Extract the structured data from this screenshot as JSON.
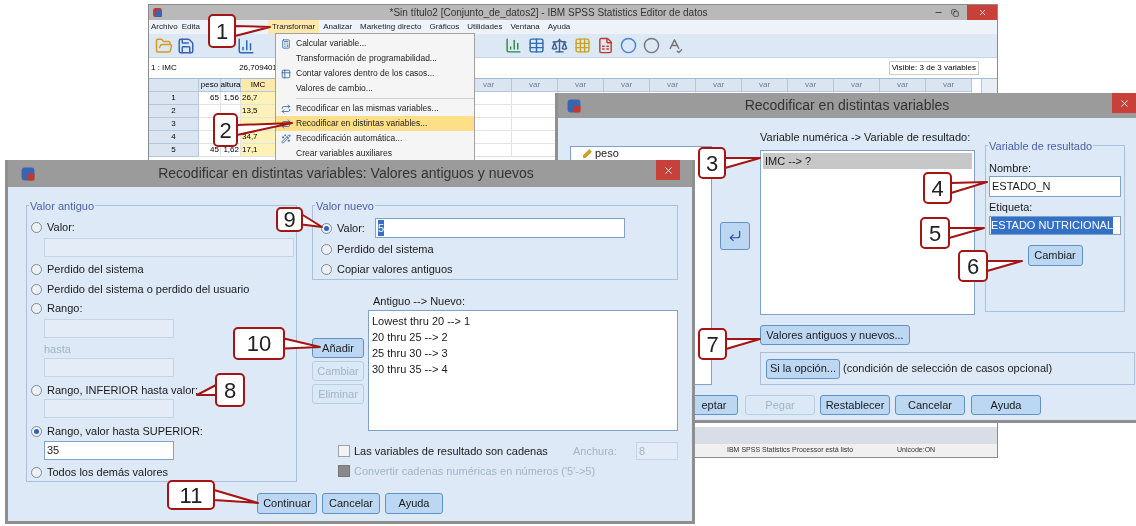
{
  "main_window": {
    "title": "*Sin título2 [Conjunto_de_datos2] - IBM SPSS Statistics Editor de datos",
    "menu": [
      {
        "label": "Archivo",
        "selected": false
      },
      {
        "label": "Edita",
        "selected": false
      },
      {
        "label": "Transformar",
        "selected": true
      },
      {
        "label": "Analizar",
        "selected": false
      },
      {
        "label": "Marketing directo",
        "selected": false
      },
      {
        "label": "Gráficos",
        "selected": false
      },
      {
        "label": "Utilidades",
        "selected": false
      },
      {
        "label": "Ventana",
        "selected": false
      },
      {
        "label": "Ayuda",
        "selected": false
      }
    ],
    "cell_reference": "1 : IMC",
    "cell_value": "26,709401",
    "visible_count": "Visible: 3 de 3 variables",
    "grid": {
      "columns": [
        "peso",
        "altura",
        "IMC"
      ],
      "var_columns": [
        "var",
        "var",
        "var",
        "var",
        "var",
        "var",
        "var",
        "var",
        "var",
        "var",
        "var"
      ],
      "rows": [
        {
          "number": "1",
          "cells": [
            "65",
            "1,56",
            "26,7"
          ]
        },
        {
          "number": "2",
          "cells": [
            null,
            null,
            "13,5"
          ]
        },
        {
          "number": "3",
          "cells": [
            null,
            null,
            null
          ]
        },
        {
          "number": "4",
          "cells": [
            null,
            null,
            "34,7"
          ]
        },
        {
          "number": "5",
          "cells": [
            "45",
            "1,62",
            "17,1"
          ]
        }
      ]
    },
    "status_bar": [
      "IBM SPSS Statistics Processor está listo",
      "Unicode:ON"
    ]
  },
  "transform_menu": [
    {
      "kind": "icon-item",
      "label": "Calcular variable...",
      "selected": false
    },
    {
      "kind": "plain-item",
      "label": "Transformación de programabilidad...",
      "selected": false
    },
    {
      "kind": "icon-item",
      "label": "Contar valores dentro de los casos...",
      "selected": false
    },
    {
      "kind": "plain-item",
      "label": "Valores de cambio...",
      "selected": false
    },
    {
      "kind": "separator"
    },
    {
      "kind": "icon-item",
      "label": "Recodificar en las mismas variables...",
      "selected": false
    },
    {
      "kind": "icon-item",
      "label": "Recodificar en distintas variables...",
      "selected": true
    },
    {
      "kind": "icon-item",
      "label": "Recodificación automática...",
      "selected": false
    },
    {
      "kind": "plain-item",
      "label": "Crear variables auxiliares",
      "selected": false
    }
  ],
  "recode_dialog": {
    "title": "Recodificar en distintas variables",
    "variables": [
      "peso"
    ],
    "mapping_label": "Variable numérica -> Variable de resultado:",
    "mappings": [
      {
        "label": "IMC --> ?",
        "selected": true
      }
    ],
    "output_group": {
      "legend": "Variable de resultado",
      "name_label": "Nombre:",
      "name_value": "ESTADO_N",
      "label_label": "Etiqueta:",
      "label_value": "ESTADO NUTRICIONAL",
      "label_selected": true,
      "change_button": "Cambiar"
    },
    "old_new_button": "Valores antiguos y nuevos...",
    "if_button": "Si la opción...",
    "if_note": "(condición de selección de casos opcional)",
    "buttons": [
      {
        "label": "eptar",
        "disabled": false
      },
      {
        "label": "Pegar",
        "disabled": true
      },
      {
        "label": "Restablecer",
        "disabled": false
      },
      {
        "label": "Cancelar",
        "disabled": false
      },
      {
        "label": "Ayuda",
        "disabled": false
      }
    ]
  },
  "values_dialog": {
    "title": "Recodificar en distintas variables: Valores antiguos y nuevos",
    "old_value": {
      "legend": "Valor antiguo",
      "options": [
        {
          "kind": "radio",
          "label": "Valor:",
          "selected": false
        },
        {
          "kind": "field",
          "disabled": true
        },
        {
          "kind": "radio",
          "label": "Perdido del sistema",
          "selected": false
        },
        {
          "kind": "radio",
          "label": "Perdido del sistema o perdido del usuario",
          "selected": false
        },
        {
          "kind": "radio",
          "label": "Rango:",
          "selected": false
        },
        {
          "kind": "field",
          "disabled": true
        },
        {
          "kind": "caption",
          "label": "hasta",
          "disabled": true
        },
        {
          "kind": "field",
          "disabled": true
        },
        {
          "kind": "radio",
          "label": "Rango, INFERIOR hasta valor:",
          "selected": false
        },
        {
          "kind": "field",
          "disabled": true
        },
        {
          "kind": "radio",
          "label": "Rango, valor hasta SUPERIOR:",
          "selected": true
        },
        {
          "kind": "field",
          "disabled": false,
          "value": "35"
        },
        {
          "kind": "radio",
          "label": "Todos los demás valores",
          "selected": false
        }
      ]
    },
    "new_value": {
      "legend": "Valor nuevo",
      "value": "5",
      "options": [
        {
          "label": "Valor:",
          "selected": true
        },
        {
          "label": "Perdido del sistema",
          "selected": false
        },
        {
          "label": "Copiar valores antiguos",
          "selected": false
        }
      ]
    },
    "list_label": "Antiguo --> Nuevo:",
    "list": [
      "Lowest thru 20 --> 1",
      "20 thru 25 --> 2",
      "25 thru 30 --> 3",
      "30 thru 35 --> 4"
    ],
    "side_buttons": [
      {
        "label": "Añadir",
        "disabled": false
      },
      {
        "label": "Cambiar",
        "disabled": true
      },
      {
        "label": "Eliminar",
        "disabled": true
      }
    ],
    "string_check": {
      "label": "Las variables de resultado son cadenas",
      "checked": false
    },
    "width_label": "Anchura:",
    "width_value": "8",
    "width_disabled": true,
    "convert_check": {
      "label": "Convertir cadenas numéricas en números ('5'->5)",
      "checked": false,
      "disabled": true
    },
    "buttons": [
      "Continuar",
      "Cancelar",
      "Ayuda"
    ]
  },
  "callouts": [
    {
      "label": "1"
    },
    {
      "label": "2"
    },
    {
      "label": "3"
    },
    {
      "label": "4"
    },
    {
      "label": "5"
    },
    {
      "label": "6"
    },
    {
      "label": "7"
    },
    {
      "label": "8"
    },
    {
      "label": "9"
    },
    {
      "label": "10"
    },
    {
      "label": "11"
    }
  ]
}
